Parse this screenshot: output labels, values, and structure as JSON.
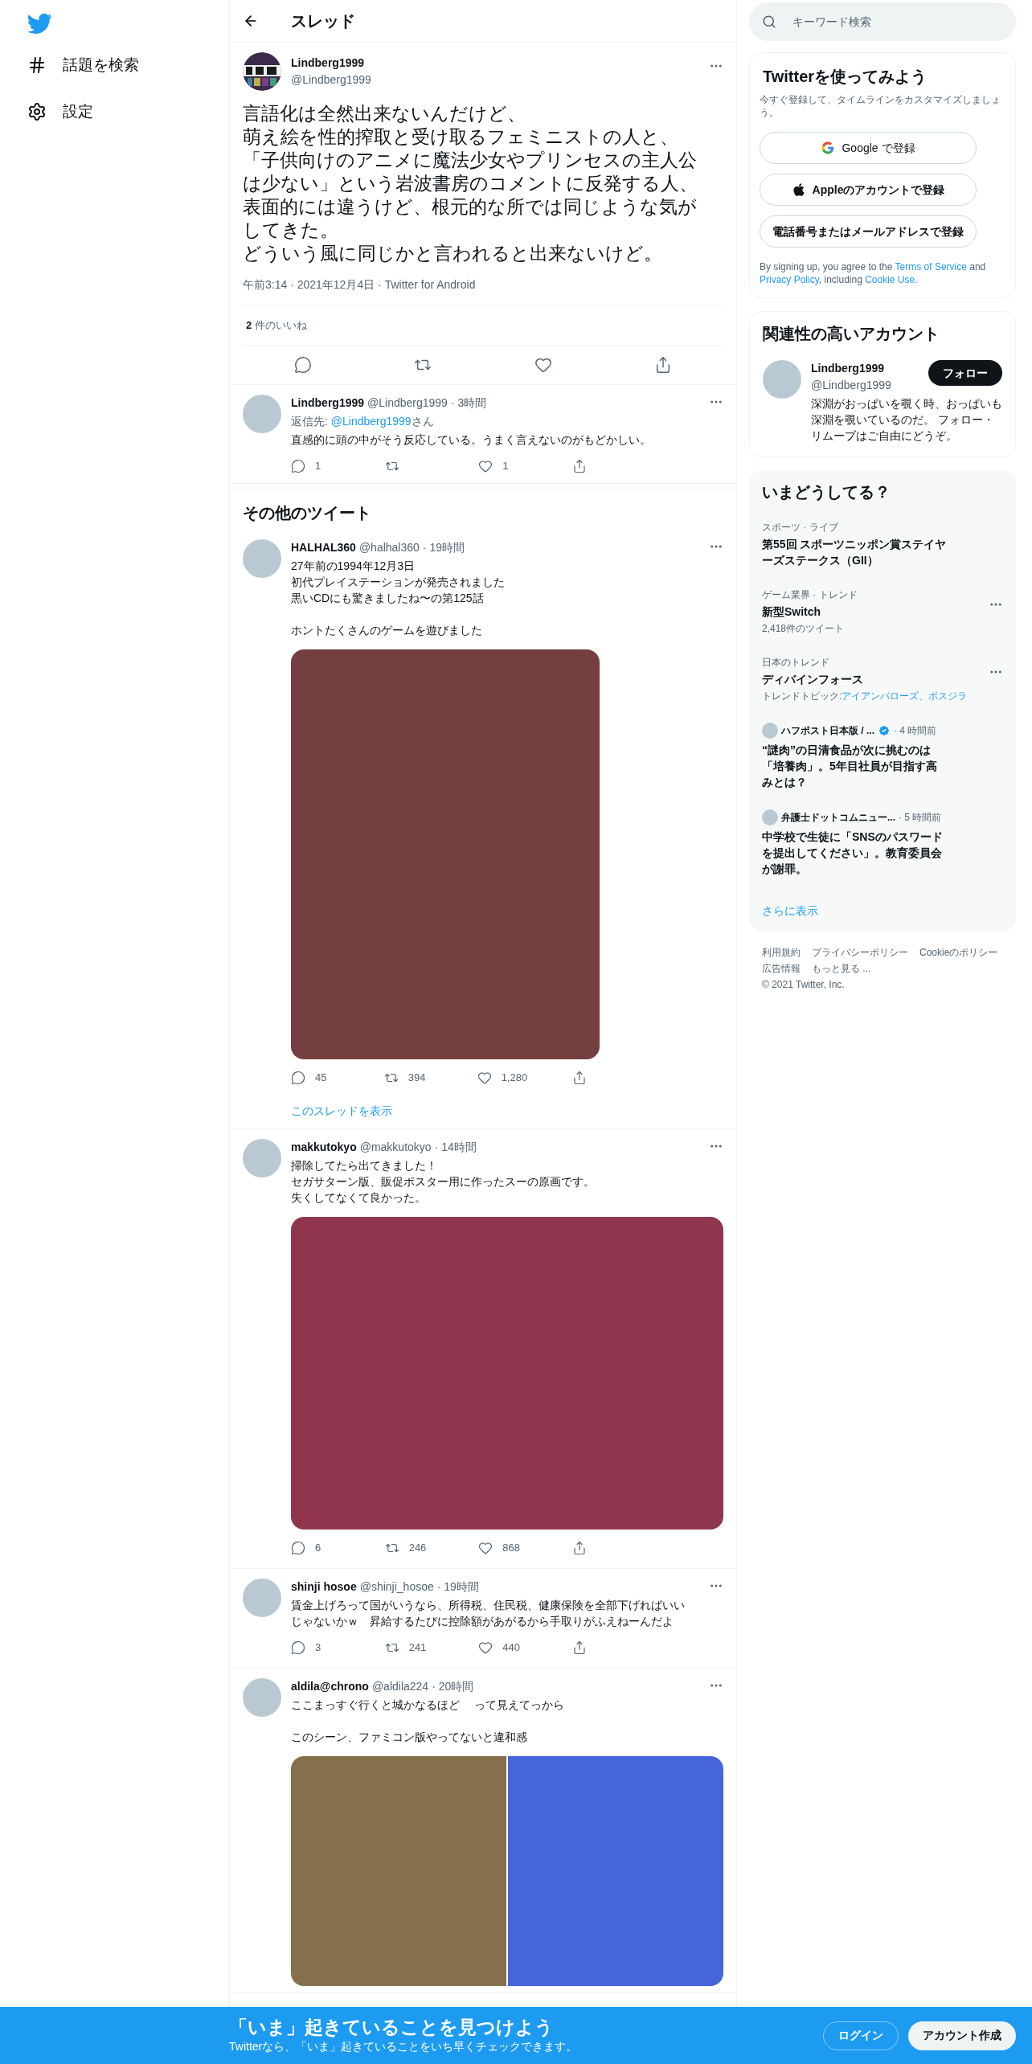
{
  "nav": {
    "items": [
      {
        "kind": "hash",
        "label": "話題を検索"
      },
      {
        "kind": "gear",
        "label": "設定"
      }
    ]
  },
  "header": {
    "title": "スレッド"
  },
  "main_tweet": {
    "name": "Lindberg1999",
    "handle": "@Lindberg1999",
    "paragraphs": [
      [
        "言語化は全然出来ないんだけど、",
        "萌え絵を性的搾取と受け取るフェミニストの人と、",
        "「子供向けのアニメに魔法少女やプリンセスの主人公は少ない」という岩波書房のコメントに反発する人、",
        "表面的には違うけど、根元的な所では同じような気がしてきた。",
        "どういう風に同じかと言われると出来ないけど。"
      ]
    ],
    "meta": "午前3:14 · 2021年12月4日 · Twitter for Android",
    "likes_count": "2",
    "likes_label": "件のいいね"
  },
  "reply": {
    "name": "Lindberg1999",
    "handle": "@Lindberg1999",
    "time": "· 3時間",
    "reply_label": "返信先: ",
    "reply_to": "@Lindberg1999",
    "reply_suffix": "さん",
    "text": "直感的に頭の中がそう反応している。うまく言えないのがもどかしい。",
    "replies": "1",
    "likes": "1"
  },
  "more_tweets": {
    "title": "その他のツイート",
    "tweets": [
      {
        "name": "HALHAL360",
        "handle": "@halhal360",
        "time": "· 19時間",
        "paragraphs": [
          [
            "27年前の1994年12月3日",
            "初代プレイステーションが発売されました",
            "黒いCDにも驚きましたね〜の第125話"
          ],
          [
            "ホントたくさんのゲームを遊びました"
          ]
        ],
        "media": {
          "kind": "portrait",
          "items": [
            {
              "color": "#763f3f"
            }
          ]
        },
        "replies": "45",
        "retweets": "394",
        "likes": "1,280",
        "show_thread": "このスレッドを表示"
      },
      {
        "name": "makkutokyo",
        "handle": "@makkutokyo",
        "time": "· 14時間",
        "paragraphs": [
          [
            "掃除してたら出てきました！",
            "セガサターン版、販促ポスター用に作ったスーの原画です。",
            "失くしてなくて良かった。"
          ]
        ],
        "media": {
          "kind": "landscape",
          "items": [
            {
              "color": "#8f364e"
            }
          ]
        },
        "replies": "6",
        "retweets": "246",
        "likes": "868"
      },
      {
        "name": "shinji hosoe",
        "handle": "@shinji_hosoe",
        "time": "· 19時間",
        "paragraphs": [
          [
            "賃金上げろって国がいうなら、所得税、住民税、健康保険を全部下げればいいじゃないかｗ　昇給するたびに控除額があがるから手取りがふえねーんだよ"
          ]
        ],
        "replies": "3",
        "retweets": "241",
        "likes": "440"
      },
      {
        "name": "aldila@chrono",
        "handle": "@aldila224",
        "time": "· 20時間",
        "paragraphs": [
          [
            "ここまっすぐ行くと城かなるほど　 って見えてっから"
          ],
          [
            "このシーン、ファミコン版やってないと違和感"
          ]
        ],
        "media": {
          "kind": "pair",
          "items": [
            {
              "color": "#85704b"
            },
            {
              "color": "#4565d9"
            }
          ]
        }
      }
    ]
  },
  "search": {
    "placeholder": "キーワード検索"
  },
  "signup": {
    "title": "Twitterを使ってみよう",
    "subtitle": "今すぐ登録して、タイムラインをカスタマイズしましょう。",
    "buttons": [
      {
        "kind": "google",
        "label": "Google で登録"
      },
      {
        "kind": "apple",
        "label": "Appleのアカウントで登録"
      },
      {
        "kind": "plain",
        "label": "電話番号またはメールアドレスで登録"
      }
    ],
    "legal": [
      {
        "text": "By signing up, you agree to the ",
        "link": false
      },
      {
        "text": "Terms of Service",
        "link": true
      },
      {
        "text": " and ",
        "link": false
      },
      {
        "text": "Privacy Policy",
        "link": true
      },
      {
        "text": ", including ",
        "link": false
      },
      {
        "text": "Cookie Use.",
        "link": true
      }
    ]
  },
  "relevant": {
    "title": "関連性の高いアカウント",
    "accounts": [
      {
        "name": "Lindberg1999",
        "handle": "@Lindberg1999",
        "bio": "深淵がおっぱいを覗く時、おっぱいも深淵を覗いているのだ。 フォロー・リムーブはご自由にどうぞ。",
        "button": "フォロー"
      }
    ]
  },
  "trends": {
    "title": "いまどうしてる？",
    "items": [
      {
        "kind": "trend",
        "category": "スポーツ · ライブ",
        "title": "第55回 スポーツニッポン賞ステイヤーズステークス（GII）",
        "menu": false
      },
      {
        "kind": "trend",
        "category": "ゲーム業界 · トレンド",
        "title": "新型Switch",
        "count": "2,418件のツイート",
        "menu": true
      },
      {
        "kind": "trend",
        "category": "日本のトレンド",
        "title": "ディバインフォース",
        "topics_label": "トレンドトピック: ",
        "topics": "アイアンバローズ、ボスジラ",
        "menu": true
      },
      {
        "kind": "news",
        "source": "ハフポスト日本版 / ...",
        "verified": true,
        "time": "· 4 時間前",
        "title": "“謎肉”の日清食品が次に挑むのは「培養肉」。5年目社員が目指す高みとは？"
      },
      {
        "kind": "news",
        "source": "弁護士ドットコムニュー...",
        "verified": false,
        "time": "· 5 時間前",
        "title": "中学校で生徒に「SNSのパスワードを提出してください」。教育委員会が謝罪。"
      }
    ],
    "show_more": "さらに表示"
  },
  "footer": {
    "links": [
      "利用規約",
      "プライバシーポリシー",
      "Cookieのポリシー",
      "広告情報",
      "もっと見る ..."
    ],
    "copyright": "© 2021 Twitter, Inc."
  },
  "banner": {
    "title": "「いま」起きていることを見つけよう",
    "subtitle": "Twitterなら、「いま」起きていることをいち早くチェックできます。",
    "login": "ログイン",
    "signup": "アカウント作成"
  }
}
